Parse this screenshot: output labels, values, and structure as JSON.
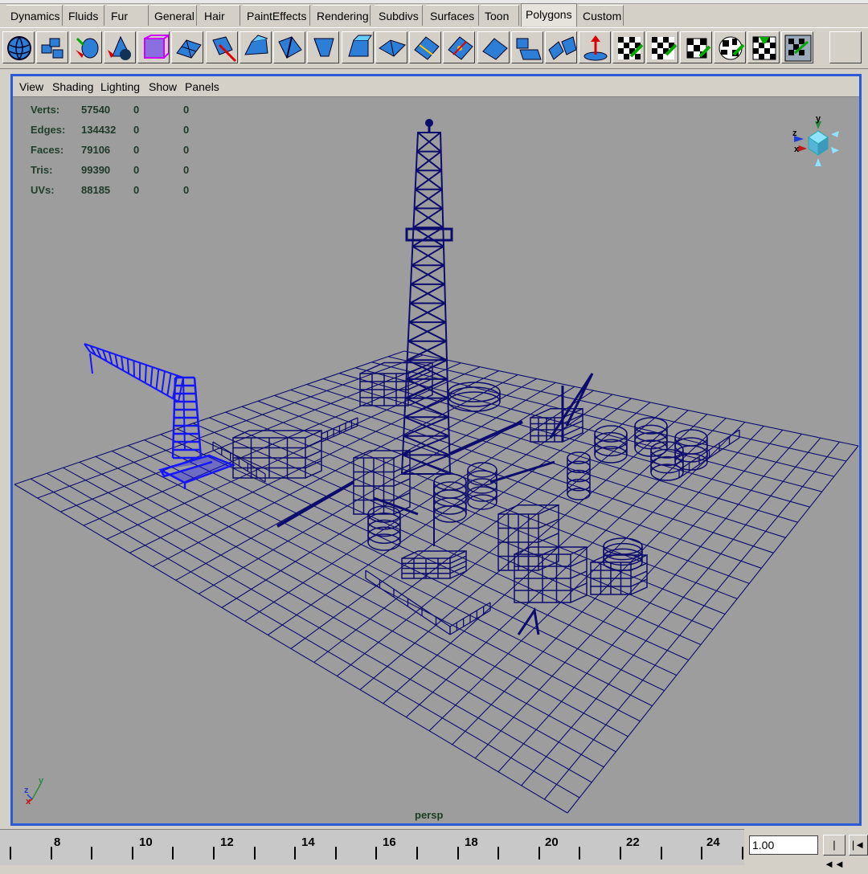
{
  "shelf_tabs": [
    {
      "label": "Dynamics",
      "active": false
    },
    {
      "label": "Fluids",
      "active": false
    },
    {
      "label": "Fur",
      "active": false
    },
    {
      "label": "General",
      "active": false
    },
    {
      "label": "Hair",
      "active": false
    },
    {
      "label": "PaintEffects",
      "active": false
    },
    {
      "label": "Rendering",
      "active": false
    },
    {
      "label": "Subdivs",
      "active": false
    },
    {
      "label": "Surfaces",
      "active": false
    },
    {
      "label": "Toon",
      "active": false
    },
    {
      "label": "Polygons",
      "active": true
    },
    {
      "label": "Custom",
      "active": false
    }
  ],
  "shelf_tools": [
    "polygon-sphere-icon",
    "polygon-cube-icon",
    "polygon-cylinder-icon",
    "polygon-cone-icon",
    "polygon-torus-icon",
    "polygon-plane-icon",
    "smooth-icon",
    "extrude-face-icon",
    "split-polygon-icon",
    "extrude-edge-icon",
    "bevel-icon",
    "bridge-icon",
    "append-polygon-icon",
    "merge-vertex-icon",
    "wedge-face-icon",
    "combine-icon",
    "separate-icon",
    "create-uvs-icon",
    "planar-mapping-icon",
    "automatic-mapping-icon",
    "cylindrical-mapping-icon",
    "spherical-mapping-icon",
    "uv-texture-editor-icon",
    "layout-uvs-icon",
    "empty-slot-icon"
  ],
  "panel_menu": {
    "view": "View",
    "shading": "Shading",
    "lighting": "Lighting",
    "show": "Show",
    "panels": "Panels"
  },
  "hud": {
    "rows": [
      {
        "label": "Verts:",
        "v1": "57540",
        "v2": "0",
        "v3": "0"
      },
      {
        "label": "Edges:",
        "v1": "134432",
        "v2": "0",
        "v3": "0"
      },
      {
        "label": "Faces:",
        "v1": "79106",
        "v2": "0",
        "v3": "0"
      },
      {
        "label": "Tris:",
        "v1": "99390",
        "v2": "0",
        "v3": "0"
      },
      {
        "label": "UVs:",
        "v1": "88185",
        "v2": "0",
        "v3": "0"
      }
    ]
  },
  "view_cube": {
    "x": "x",
    "y": "y",
    "z": "z"
  },
  "axis_gizmo": {
    "x": "x",
    "y": "y",
    "z": "z"
  },
  "camera_label": "persp",
  "colors": {
    "wire": "#0c0c6e",
    "selected": "#1515ff",
    "viewport_bg": "#9d9d9d",
    "viewport_border": "#2a5bd7"
  },
  "timeline": {
    "ticks": [
      "8",
      "10",
      "12",
      "14",
      "16",
      "18",
      "20",
      "22",
      "24"
    ],
    "current_frame": "1.00",
    "buttons": {
      "rewind": "|◄◄",
      "step_back": "|◄"
    }
  }
}
